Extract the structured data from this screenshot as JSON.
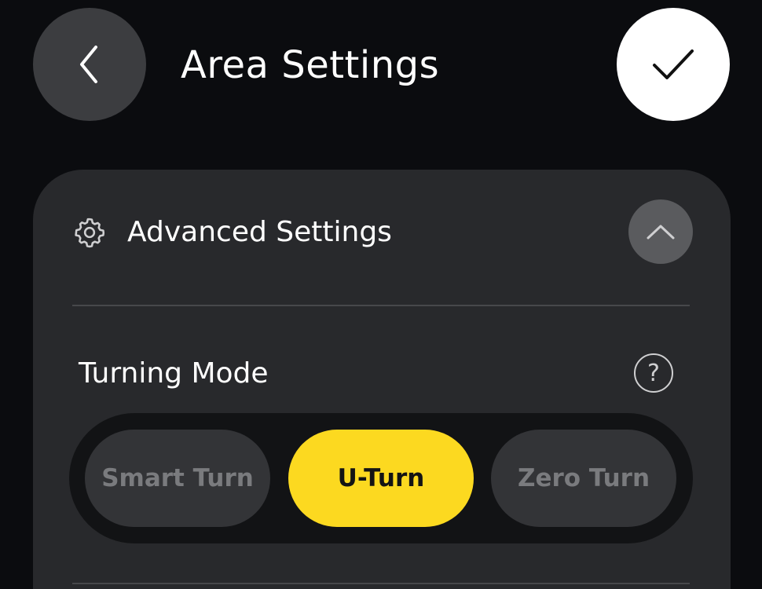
{
  "header": {
    "title": "Area Settings",
    "back_icon": "chevron-left-icon",
    "confirm_icon": "checkmark-icon"
  },
  "advanced": {
    "label": "Advanced Settings",
    "icon": "gear-icon",
    "toggle_icon": "chevron-up-icon",
    "expanded": true
  },
  "turning_mode": {
    "label": "Turning Mode",
    "help_symbol": "?",
    "options": [
      {
        "label": "Smart Turn",
        "selected": false
      },
      {
        "label": "U-Turn",
        "selected": true
      },
      {
        "label": "Zero Turn",
        "selected": false
      }
    ]
  },
  "colors": {
    "background": "#0b0c0f",
    "card": "#28292c",
    "accent": "#fcd920",
    "segment_inactive": "#333437",
    "segment_track": "#121315"
  }
}
